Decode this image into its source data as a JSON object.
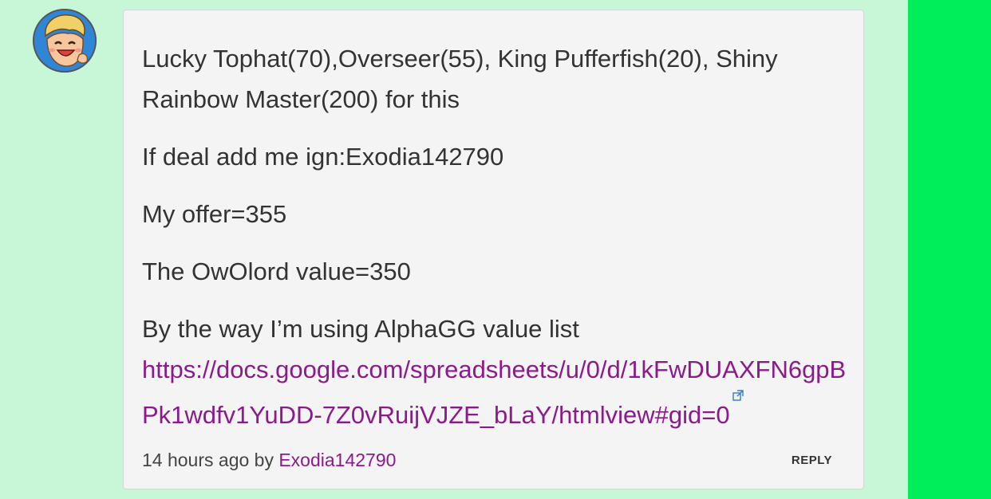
{
  "comment": {
    "paragraphs": [
      "Lucky Tophat(70),Overseer(55), King Pufferfish(20), Shiny Rainbow Master(200) for this",
      "If deal add me ign:Exodia142790",
      "My offer=355",
      "The OwOlord value=350",
      "By the way I’m using AlphaGG value list"
    ],
    "link_text": "https://docs.google.com/spreadsheets/u/0/d/1kFwDUAXFN6gpBPk1wdfv1YuDD-7Z0vRuijVJZE_bLaY/htmlview#gid=0"
  },
  "footer": {
    "time_prefix": "14 hours ago by ",
    "author": "Exodia142790",
    "reply_label": "REPLY"
  },
  "colors": {
    "background": "#c8f7d8",
    "sidebar_stripe": "#00ee5a",
    "link": "#8b1a8b",
    "card": "#f4f4f4"
  },
  "icons": {
    "avatar": "cartoon-face-avatar",
    "external_link": "external-link-icon"
  }
}
